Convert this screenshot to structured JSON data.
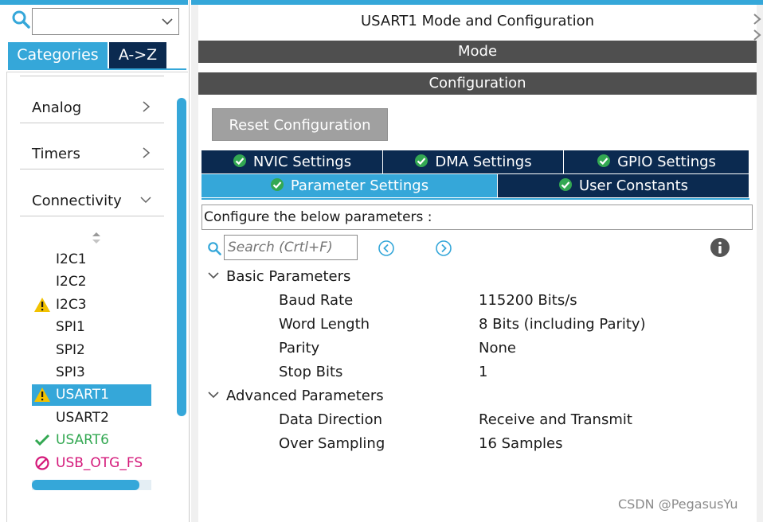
{
  "left": {
    "search": {
      "value": ""
    },
    "tabs": [
      {
        "label": "Categories"
      },
      {
        "label": "A->Z"
      }
    ],
    "categories": [
      {
        "label": "Analog"
      },
      {
        "label": "Timers"
      },
      {
        "label": "Connectivity"
      }
    ],
    "peripherals": [
      {
        "label": "I2C1",
        "status": "none"
      },
      {
        "label": "I2C2",
        "status": "none"
      },
      {
        "label": "I2C3",
        "status": "warning"
      },
      {
        "label": "SPI1",
        "status": "none"
      },
      {
        "label": "SPI2",
        "status": "none"
      },
      {
        "label": "SPI3",
        "status": "none"
      },
      {
        "label": "USART1",
        "status": "warning",
        "selected": true
      },
      {
        "label": "USART2",
        "status": "none"
      },
      {
        "label": "USART6",
        "status": "ok"
      },
      {
        "label": "USB_OTG_FS",
        "status": "error"
      }
    ]
  },
  "main": {
    "title": "USART1 Mode and Configuration",
    "mode_label": "Mode",
    "config_label": "Configuration",
    "reset_button": "Reset Configuration",
    "tabs": [
      {
        "label": "NVIC Settings"
      },
      {
        "label": "DMA Settings"
      },
      {
        "label": "GPIO Settings"
      },
      {
        "label": "Parameter Settings"
      },
      {
        "label": "User Constants"
      }
    ],
    "configure_text": "Configure the below parameters :",
    "search_placeholder": "Search (Crtl+F)",
    "groups": [
      {
        "label": "Basic Parameters",
        "params": [
          {
            "name": "Baud Rate",
            "value": "115200 Bits/s"
          },
          {
            "name": "Word Length",
            "value": "8 Bits (including Parity)"
          },
          {
            "name": "Parity",
            "value": "None"
          },
          {
            "name": "Stop Bits",
            "value": "1"
          }
        ]
      },
      {
        "label": "Advanced Parameters",
        "params": [
          {
            "name": "Data Direction",
            "value": "Receive and Transmit"
          },
          {
            "name": "Over Sampling",
            "value": "16 Samples"
          }
        ]
      }
    ]
  },
  "watermark": "CSDN @PegasusYu",
  "colors": {
    "accent": "#35a7d9",
    "navy": "#0b2a50",
    "bar": "#4f4f4f",
    "ok": "#33a852",
    "warning": "#f2c200",
    "error": "#d4197a"
  },
  "icons": {
    "search": "search-icon",
    "dropdown": "chevron-down-icon",
    "tab_check": "check-circle-icon",
    "info": "info-icon",
    "prev": "arrow-left-circle-icon",
    "next": "arrow-right-circle-icon"
  }
}
